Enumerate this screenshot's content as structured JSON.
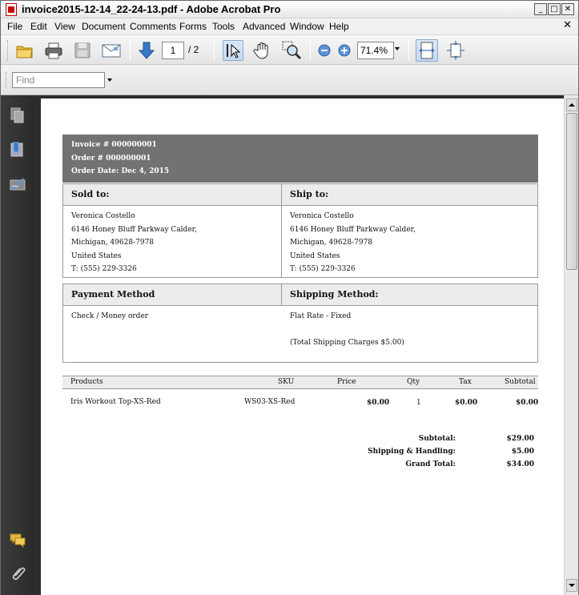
{
  "window": {
    "title": "invoice2015-12-14_22-24-13.pdf - Adobe Acrobat Pro",
    "minimize": "_",
    "maximize": "□",
    "close": "✕"
  },
  "menu": {
    "items": [
      "File",
      "Edit",
      "View",
      "Document",
      "Comments",
      "Forms",
      "Tools",
      "Advanced",
      "Window",
      "Help"
    ],
    "close_doc": "✕"
  },
  "toolbar": {
    "page_current": "1",
    "page_total": "/ 2",
    "zoom": "71.4%"
  },
  "find": {
    "placeholder": "Find"
  },
  "icons": {
    "open": "folder-open-icon",
    "print": "printer-icon",
    "save": "save-disk-icon",
    "email": "email-icon",
    "next_page": "arrow-down-icon",
    "select": "select-cursor-icon",
    "hand": "hand-icon",
    "zoom_tool": "magnifier-icon",
    "zoom_out": "zoom-out-icon",
    "zoom_in": "zoom-in-icon",
    "fit_width": "fit-width-icon",
    "fit_page": "fit-page-icon",
    "pages_panel": "pages-icon",
    "bookmarks_panel": "bookmark-icon",
    "signatures_panel": "signature-icon",
    "comments_panel": "comments-icon",
    "attachments_panel": "paperclip-icon"
  },
  "colors": {
    "nav_bg": "#2c2c2c",
    "header_band": "#727272",
    "section_header": "#ececec",
    "accent_blue": "#3a78c8"
  },
  "invoice": {
    "header": {
      "invoice_no": "Invoice # 000000001",
      "order_no": "Order # 000000001",
      "order_date": "Order Date: Dec 4, 2015"
    },
    "sold_to": {
      "label": "Sold to:",
      "lines": [
        "Veronica Costello",
        "6146 Honey Bluff Parkway Calder,",
        "Michigan, 49628-7978",
        "United States",
        "T: (555) 229-3326"
      ]
    },
    "ship_to": {
      "label": "Ship to:",
      "lines": [
        "Veronica Costello",
        "6146 Honey Bluff Parkway Calder,",
        "Michigan, 49628-7978",
        "United States",
        "T: (555) 229-3326"
      ]
    },
    "payment": {
      "label": "Payment Method",
      "value": "Check / Money order"
    },
    "shipping": {
      "label": "Shipping Method:",
      "value": "Flat Rate - Fixed",
      "charges": "(Total Shipping Charges $5.00)"
    },
    "products": {
      "columns": [
        "Products",
        "SKU",
        "Price",
        "Qty",
        "Tax",
        "Subtotal"
      ],
      "rows": [
        {
          "name": "Iris Workout Top-XS-Red",
          "sku": "WS03-XS-Red",
          "price": "$0.00",
          "qty": "1",
          "tax": "$0.00",
          "subtotal": "$0.00"
        }
      ]
    },
    "totals": [
      {
        "label": "Subtotal:",
        "value": "$29.00"
      },
      {
        "label": "Shipping & Handling:",
        "value": "$5.00"
      },
      {
        "label": "Grand Total:",
        "value": "$34.00"
      }
    ]
  }
}
